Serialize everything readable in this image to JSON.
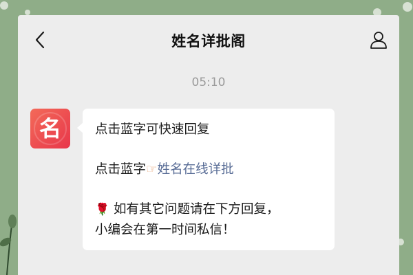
{
  "header": {
    "title": "姓名详批阁",
    "back_icon": "chevron-left-icon",
    "profile_icon": "person-outline-icon"
  },
  "timestamp": "05:10",
  "avatar": {
    "text": "名",
    "color": "#ec4a4f"
  },
  "message": {
    "line1": "点击蓝字可快速回复",
    "line2_prefix": "点击蓝字",
    "pointer_icon": "☞",
    "line2_link": "姓名在线详批",
    "rose_icon": "🌹",
    "line3": " 如有其它问题请在下方回复，",
    "line4": "小编会在第一时间私信！"
  },
  "colors": {
    "background": "#8fad88",
    "panel": "#ededed",
    "bubble": "#ffffff",
    "link": "#576b95",
    "timestamp": "#9a9a9a"
  }
}
